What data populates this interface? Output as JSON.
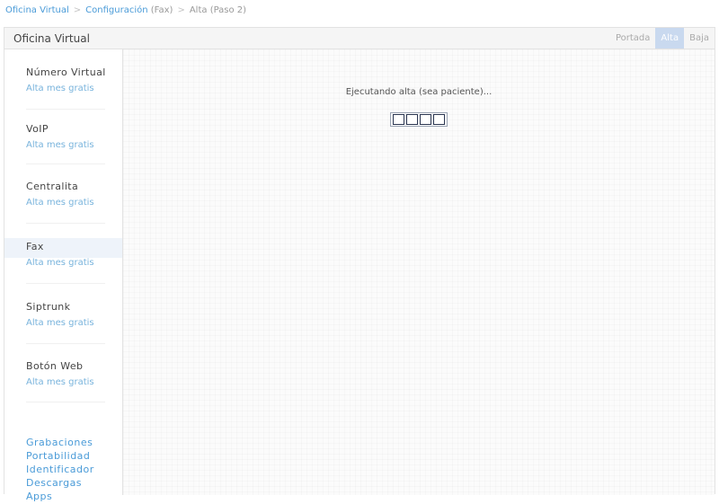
{
  "breadcrumb": {
    "home": "Oficina Virtual",
    "section": "Configuración",
    "section_suffix": "(Fax)",
    "current": "Alta (Paso 2)",
    "separator": ">"
  },
  "panel": {
    "title": "Oficina Virtual",
    "tabs": [
      {
        "label": "Portada",
        "active": false
      },
      {
        "label": "Alta",
        "active": true
      },
      {
        "label": "Baja",
        "active": false
      }
    ]
  },
  "sidebar": {
    "items": [
      {
        "name": "Número Virtual",
        "sub": "Alta mes gratis"
      },
      {
        "name": "VoIP",
        "sub": "Alta mes gratis"
      },
      {
        "name": "Centralita",
        "sub": "Alta mes gratis"
      },
      {
        "name": "Fax",
        "sub": "Alta mes gratis",
        "active": true
      },
      {
        "name": "Siptrunk",
        "sub": "Alta mes gratis"
      },
      {
        "name": "Botón Web",
        "sub": "Alta mes gratis"
      }
    ],
    "links": [
      "Grabaciones",
      "Portabilidad",
      "Identificador",
      "Descargas",
      "Apps"
    ]
  },
  "main": {
    "status": "Ejecutando alta (sea paciente)..."
  },
  "colors": {
    "link": "#4a9bd8",
    "active_tab": "#c9d9ef",
    "active_item": "#eef3fa"
  }
}
